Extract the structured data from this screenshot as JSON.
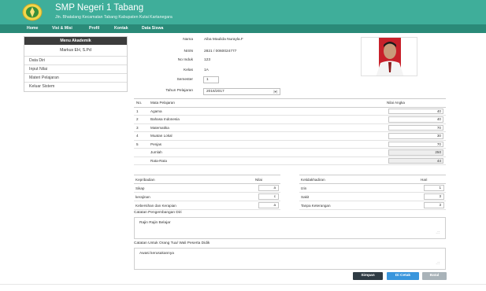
{
  "header": {
    "title": "SMP Negeri 1 Tabang",
    "subtitle": "Jln. Bhatalang Kecamatan Tabang Kabupaten Kutai Kartanegara",
    "bg_color": "#3fae9a",
    "logo_icon": "school-emblem-icon"
  },
  "nav": {
    "items": [
      {
        "label": "Home"
      },
      {
        "label": "Visi & Misi"
      },
      {
        "label": "Profil"
      },
      {
        "label": "Kontak"
      },
      {
        "label": "Data Siswa"
      }
    ],
    "bg_color": "#2a8a78"
  },
  "sidebar": {
    "heading": "Menu Akademik",
    "user": "Markus EH, S.Pd",
    "items": [
      {
        "label": "Data Diri"
      },
      {
        "label": "Input Nilai"
      },
      {
        "label": "Materi Pelajaran"
      },
      {
        "label": "Keluar Sistem"
      }
    ]
  },
  "student": {
    "name_label": "Nama",
    "name": "Aiba Maulida Nurayla.F",
    "nisn_label": "NISN",
    "nisn": "2821 / 0060024777",
    "induk_label": "No Induk",
    "induk": "123",
    "kelas_label": "Kelas",
    "kelas": "1A",
    "semester_label": "Semester",
    "semester": "1",
    "tahun_label": "Tahun Pelajaran",
    "tahun": "2016/2017"
  },
  "grades": {
    "headers": {
      "no": "No.",
      "subject": "Mata Pelajaran",
      "score": "Nilai Angka"
    },
    "rows": [
      {
        "no": "1",
        "subject": "Agama",
        "score": "40"
      },
      {
        "no": "2",
        "subject": "Bahasa Indonesia",
        "score": "40"
      },
      {
        "no": "3",
        "subject": "Matematika",
        "score": "70"
      },
      {
        "no": "4",
        "subject": "Muatan Lokal",
        "score": "30"
      },
      {
        "no": "5",
        "subject": "Penjas",
        "score": "70"
      }
    ],
    "total_label": "Jumlah",
    "total": "250",
    "avg_label": "Rata-Rata",
    "avg": "44"
  },
  "behavior": {
    "header_label": "Kepribadian",
    "header_value": "Nilai",
    "rows": [
      {
        "label": "Sikap",
        "value": "a"
      },
      {
        "label": "kerajinan",
        "value": "c"
      },
      {
        "label": "Kebersihan dan Kerapian",
        "value": "a"
      }
    ]
  },
  "attendance": {
    "header_label": "Ketidakhadiran",
    "header_value": "Hari",
    "rows": [
      {
        "label": "Izin",
        "value": "1"
      },
      {
        "label": "Sakit",
        "value": "3"
      },
      {
        "label": "Tanpa Keterangan",
        "value": "3"
      }
    ]
  },
  "notes": {
    "teacher_label": "Catatan Pengembangan Diri",
    "teacher_text": "Rajin Rajin Belajar",
    "parent_label": "Catatan Untuk Orang Tua/ Wali Peserta Didik",
    "parent_text": "Awasi kerusakannya"
  },
  "buttons": {
    "save": "Simpan",
    "print": "Di Cetak",
    "exit": "Batal"
  }
}
